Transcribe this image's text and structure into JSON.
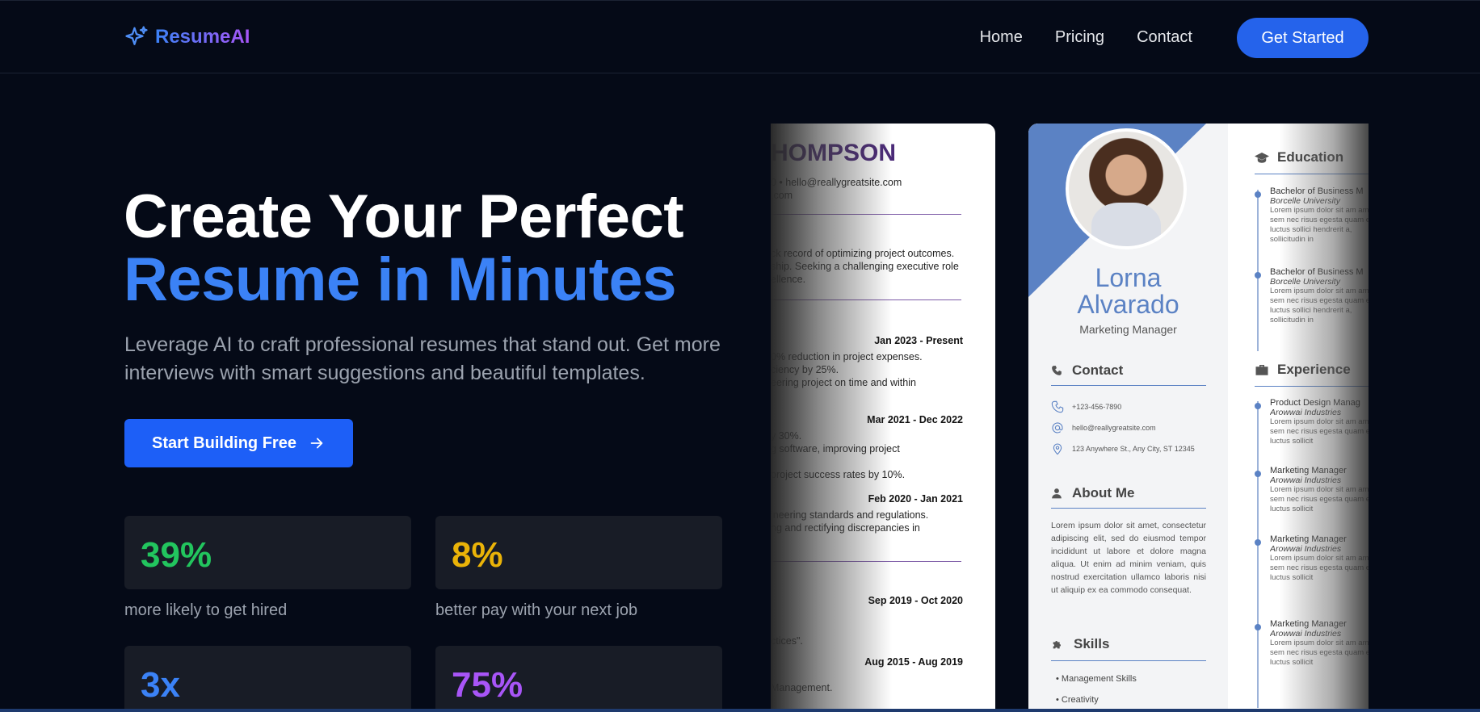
{
  "brand": {
    "name": "ResumeAI",
    "accent": "#3b82f6",
    "accent2": "#a855f7"
  },
  "nav": {
    "links": [
      "Home",
      "Pricing",
      "Contact"
    ],
    "cta": "Get Started"
  },
  "hero": {
    "title_line1": "Create Your Perfect",
    "title_line2": "Resume in Minutes",
    "subtitle": "Leverage AI to craft professional resumes that stand out. Get more interviews with smart suggestions and beautiful templates.",
    "button": "Start Building Free"
  },
  "stats": [
    {
      "value": "39%",
      "label": "more likely to get hired",
      "color": "#22c55e"
    },
    {
      "value": "8%",
      "label": "better pay with your next job",
      "color": "#eab308"
    },
    {
      "value": "3x",
      "label": "",
      "color": "#3b82f6"
    },
    {
      "value": "75%",
      "label": "",
      "color": "#a855f7"
    }
  ],
  "resume1": {
    "name": "HOMPSON",
    "contact1": "0 • hello@reallygreatsite.com",
    "contact2": ".com",
    "summary": [
      "ck record of optimizing project outcomes.",
      "ship. Seeking a challenging executive role",
      "ellence."
    ],
    "jobs": [
      {
        "date": "Jan 2023 - Present",
        "lines": [
          "0% reduction in project expenses.",
          "ciency by 25%.",
          "eering project on time and within"
        ]
      },
      {
        "date": "Mar 2021 - Dec 2022",
        "lines": [
          "y 30%.",
          "g software, improving project",
          "project success rates by 10%."
        ]
      },
      {
        "date": "Feb 2020 - Jan 2021",
        "lines": [
          "ineering standards and regulations.",
          "ng and rectifying discrepancies in"
        ]
      },
      {
        "date": "Sep 2019 - Oct 2020",
        "lines": [
          "ctices\"."
        ]
      },
      {
        "date": "Aug 2015 - Aug 2019",
        "lines": [
          "Management."
        ]
      }
    ]
  },
  "resume2": {
    "first_name": "Lorna",
    "last_name": "Alvarado",
    "role": "Marketing Manager",
    "sections": {
      "contact": "Contact",
      "about": "About Me",
      "skills": "Skills",
      "education": "Education",
      "experience": "Experience"
    },
    "contact": {
      "phone": "+123-456-7890",
      "email": "hello@reallygreatsite.com",
      "address": "123 Anywhere St., Any City, ST 12345"
    },
    "about": "Lorem ipsum dolor sit amet, consectetur adipiscing elit, sed do eiusmod tempor incididunt ut labore et dolore magna aliqua. Ut enim ad minim veniam, quis nostrud exercitation ullamco laboris nisi ut aliquip ex ea commodo consequat.",
    "skills": [
      "Management Skills",
      "Creativity"
    ],
    "education": [
      {
        "title": "Bachelor of Business M",
        "school": "Borcelle University",
        "desc": "Lorem ipsum dolor sit am amet sem nec risus egesta quam eget, luctus sollici hendrerit a, sollicitudin in"
      },
      {
        "title": "Bachelor of Business M",
        "school": "Borcelle University",
        "desc": "Lorem ipsum dolor sit am amet sem nec risus egesta quam eget, luctus sollici hendrerit a, sollicitudin in"
      }
    ],
    "experience": [
      {
        "title": "Product Design Manag",
        "company": "Arowwai Industries",
        "desc": "Lorem ipsum dolor sit am amet sem nec risus egesta quam eget, luctus sollicit"
      },
      {
        "title": "Marketing Manager",
        "company": "Arowwai Industries",
        "desc": "Lorem ipsum dolor sit am amet sem nec risus egesta quam eget, luctus sollicit"
      },
      {
        "title": "Marketing Manager",
        "company": "Arowwai Industries",
        "desc": "Lorem ipsum dolor sit am amet sem nec risus egesta quam eget, luctus sollicit"
      },
      {
        "title": "Marketing Manager",
        "company": "Arowwai Industries",
        "desc": "Lorem ipsum dolor sit am amet sem nec risus egesta quam eget, luctus sollicit"
      }
    ]
  }
}
